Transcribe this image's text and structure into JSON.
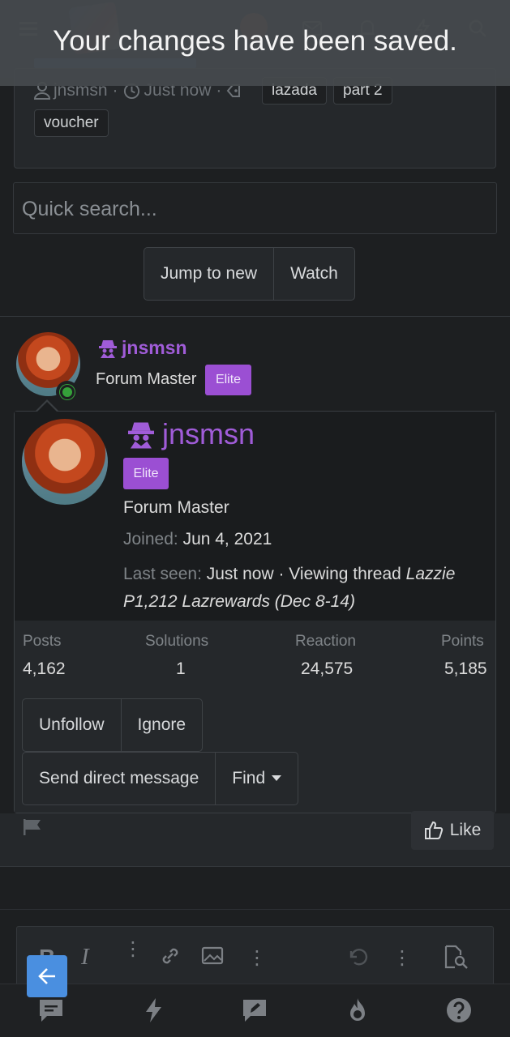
{
  "toast": {
    "message": "Your changes have been saved."
  },
  "thread": {
    "author": "jnsmsn",
    "time": "Just now",
    "tags": [
      "lazada",
      "part 2",
      "voucher"
    ]
  },
  "search": {
    "placeholder": "Quick search..."
  },
  "thread_actions": {
    "jump_label": "Jump to new",
    "watch_label": "Watch"
  },
  "post_author": {
    "username": "jnsmsn",
    "title": "Forum Master",
    "badge": "Elite"
  },
  "member_card": {
    "username": "jnsmsn",
    "badge": "Elite",
    "title": "Forum Master",
    "joined_label": "Joined:",
    "joined_value": "Jun 4, 2021",
    "last_seen_label": "Last seen:",
    "last_seen_value": "Just now · Viewing thread",
    "last_seen_thread": "Lazzie P1,212 Lazrewards (Dec 8-14)",
    "stats": [
      {
        "label": "Posts",
        "value": "4,162"
      },
      {
        "label": "Solutions",
        "value": "1"
      },
      {
        "label": "Reaction",
        "value": "24,575"
      },
      {
        "label": "Points",
        "value": "5,185"
      }
    ],
    "unfollow_label": "Unfollow",
    "ignore_label": "Ignore",
    "message_label": "Send direct message",
    "find_label": "Find"
  },
  "post_footer": {
    "like_label": "Like"
  },
  "colors": {
    "accent_purple": "#9b4fd3",
    "username_purple": "#a05cd8",
    "online_green": "#35a13a",
    "back_blue": "#4a8fe0"
  }
}
